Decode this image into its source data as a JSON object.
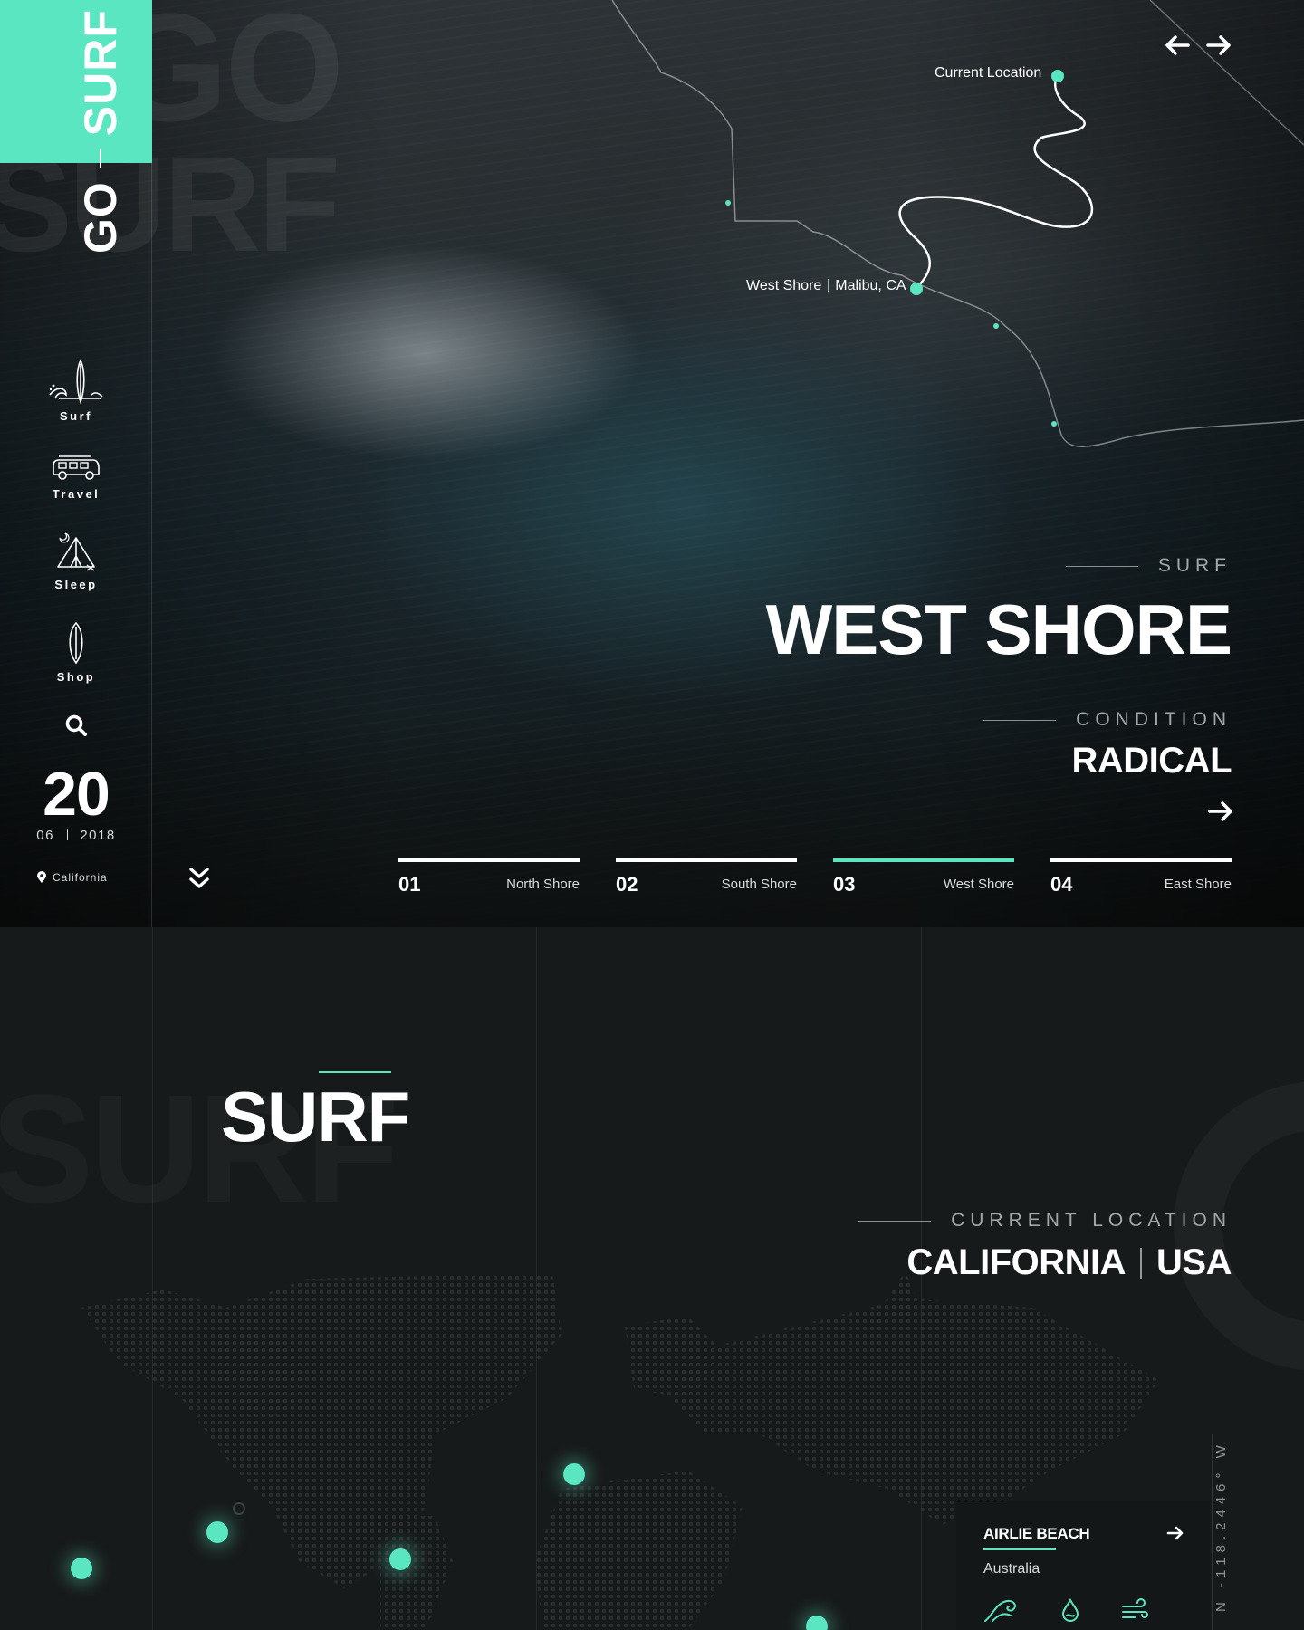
{
  "brand": {
    "word1": "GO",
    "word2": "SURF",
    "accent": "#5be6c2"
  },
  "nav": [
    {
      "label": "Surf",
      "icon": "surfboard-wave-icon"
    },
    {
      "label": "Travel",
      "icon": "van-icon"
    },
    {
      "label": "Sleep",
      "icon": "tent-icon"
    },
    {
      "label": "Shop",
      "icon": "surfboard-icon"
    }
  ],
  "date": {
    "day": "20",
    "month": "06",
    "year": "2018"
  },
  "location_tag": "California",
  "map_pins": {
    "current": "Current Location",
    "spot_name": "West Shore",
    "spot_place": "Malibu, CA"
  },
  "hero": {
    "eyebrow": "SURF",
    "title": "WEST SHORE",
    "condition_label": "CONDITION",
    "condition_value": "RADICAL"
  },
  "shores": [
    {
      "num": "01",
      "name": "North Shore",
      "active": false
    },
    {
      "num": "02",
      "name": "South Shore",
      "active": false
    },
    {
      "num": "03",
      "name": "West Shore",
      "active": true
    },
    {
      "num": "04",
      "name": "East Shore",
      "active": false
    }
  ],
  "section": {
    "title": "SURF",
    "current_label": "CURRENT LOCATION",
    "region": "CALIFORNIA",
    "country": "USA",
    "coords": "N -118.2446° W"
  },
  "beach_card": {
    "name": "AIRLIE BEACH",
    "country": "Australia",
    "icons": [
      "wave-icon",
      "water-drop-icon",
      "wind-icon"
    ]
  }
}
